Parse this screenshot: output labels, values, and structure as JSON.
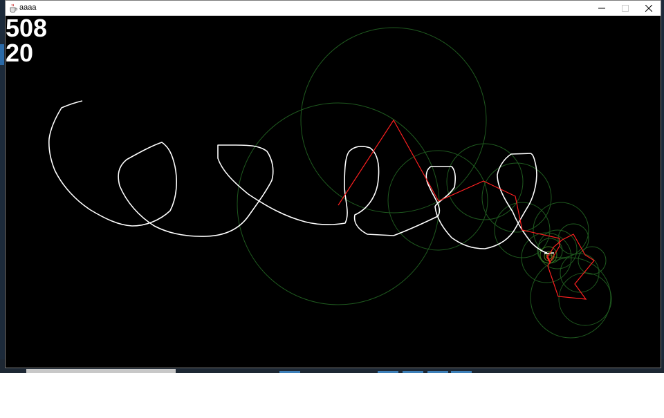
{
  "window": {
    "title": "aaaa"
  },
  "overlay": {
    "counter_top": "508",
    "counter_bottom": "20"
  },
  "colors": {
    "background": "#000000",
    "trace": "#ffffff",
    "arms": "#ff2020",
    "circles": "#1f5a1f"
  },
  "icons": {
    "app": "java-cup-icon",
    "minimize": "minimize-icon",
    "maximize": "maximize-icon",
    "close": "close-icon"
  }
}
